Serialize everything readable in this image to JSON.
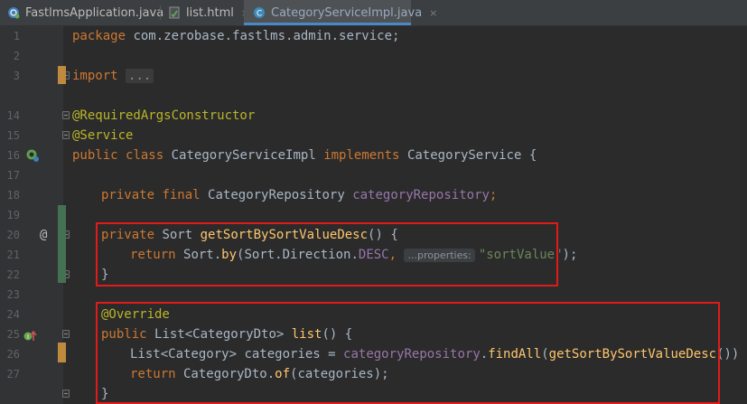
{
  "tabs": [
    {
      "label": "FastlmsApplication.java",
      "icon": "spring-boot-class-icon",
      "active": false
    },
    {
      "label": "list.html",
      "icon": "html-file-icon",
      "active": false
    },
    {
      "label": "CategoryServiceImpl.java",
      "icon": "java-class-icon",
      "active": true
    }
  ],
  "close_glyph": "×",
  "gutter": {
    "line_numbers": [
      "1",
      "2",
      "3",
      "14",
      "15",
      "16",
      "17",
      "18",
      "19",
      "20",
      "21",
      "22",
      "23",
      "24",
      "25",
      "26",
      "27"
    ],
    "override_marker": "@"
  },
  "code": {
    "l1": {
      "kw": "package",
      "text": " com.zerobase.fastlms.admin.service;"
    },
    "l3": {
      "kw": "import",
      "fold": "..."
    },
    "l14": {
      "ann": "@RequiredArgsConstructor"
    },
    "l15": {
      "ann": "@Service"
    },
    "l16": {
      "kw1": "public",
      "kw2": "class",
      "name": "CategoryServiceImpl",
      "kw3": "implements",
      "iface": "CategoryService",
      "brace": "{"
    },
    "l18": {
      "kw1": "private",
      "kw2": "final",
      "type": "CategoryRepository",
      "field": "categoryRepository",
      "end": ";"
    },
    "l20": {
      "kw": "private",
      "type": "Sort",
      "fn": "getSortBySortValueDesc",
      "rest": "() {"
    },
    "l21": {
      "kw": "return",
      "p1": "Sort.",
      "fn": "by",
      "p2": "(Sort.Direction.",
      "fld": "DESC",
      "p3": ", ",
      "hint": "...properties:",
      "str": "\"sortValue\"",
      "end": ");"
    },
    "l22": {
      "text": "}"
    },
    "l24": {
      "ann": "@Override"
    },
    "l25": {
      "kw": "public",
      "type": "List<CategoryDto>",
      "fn": "list",
      "rest": "() {"
    },
    "l26": {
      "type": "List<Category>",
      "var": " categories = ",
      "field": "categoryRepository",
      "dot": ".",
      "fn": "findAll",
      "p1": "(",
      "fn2": "getSortBySortValueDesc",
      "end": "());"
    },
    "l27": {
      "kw": "return",
      "p1": " CategoryDto.",
      "fn": "of",
      "end": "(categories);"
    },
    "l28": {
      "text": "}"
    }
  },
  "colors": {
    "keyword": "#cc7832",
    "annotation": "#bbb529",
    "method": "#ffc66d",
    "field": "#9876aa",
    "string": "#6a8759",
    "highlight_box": "#e21a1a"
  }
}
